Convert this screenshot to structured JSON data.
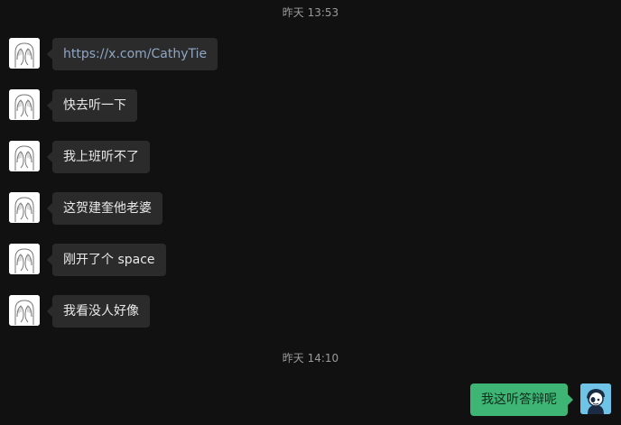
{
  "timestamps": {
    "first": "昨天 13:53",
    "second": "昨天 14:10"
  },
  "messages_in": [
    {
      "text": "https://x.com/CathyTie",
      "kind": "link"
    },
    {
      "text": "快去听一下",
      "kind": "text"
    },
    {
      "text": "我上班听不了",
      "kind": "text"
    },
    {
      "text": "这贺建奎他老婆",
      "kind": "text"
    },
    {
      "text": "刚开了个 space",
      "kind": "text"
    },
    {
      "text": "我看没人好像",
      "kind": "text"
    }
  ],
  "message_out": {
    "text": "我这听答辩呢"
  },
  "avatars": {
    "incoming_icon": "hands-over-face-icon",
    "outgoing_icon": "cartoon-person-icon"
  },
  "colors": {
    "background": "#111111",
    "incoming_bubble": "#2b2b2b",
    "outgoing_bubble": "#3eb575",
    "link_text": "#8fa6c4"
  }
}
